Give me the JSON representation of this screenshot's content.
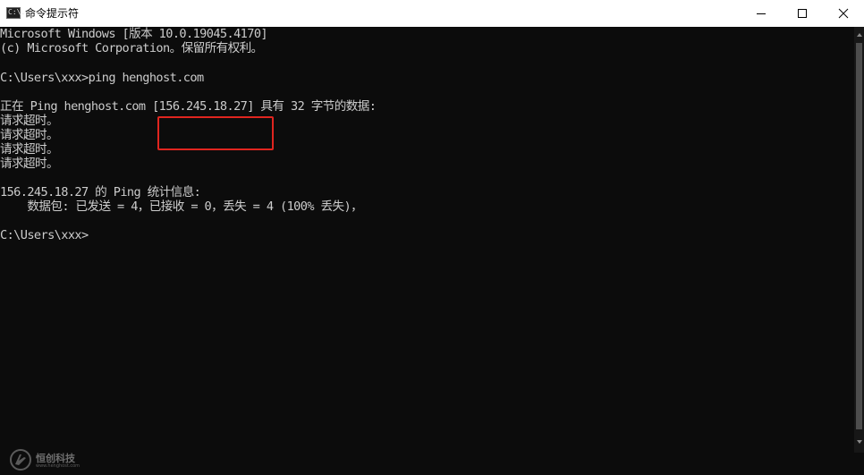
{
  "window": {
    "title": "命令提示符",
    "icon": "cmd-icon",
    "icon_label": "C:\\."
  },
  "console": {
    "lines": [
      "Microsoft Windows [版本 10.0.19045.4170]",
      "(c) Microsoft Corporation。保留所有权利。",
      "",
      "C:\\Users\\xxx>ping henghost.com",
      "",
      "正在 Ping henghost.com [156.245.18.27] 具有 32 字节的数据:",
      "请求超时。",
      "请求超时。",
      "请求超时。",
      "请求超时。",
      "",
      "156.245.18.27 的 Ping 统计信息:",
      "    数据包: 已发送 = 4，已接收 = 0，丢失 = 4 (100% 丢失)，",
      "",
      "C:\\Users\\xxx>"
    ],
    "highlighted_text": "[156.245.18.27]",
    "highlight_color": "#e0251f",
    "text_color": "#cccccc",
    "background_color": "#0c0c0c"
  },
  "watermark": {
    "name": "恒创科技",
    "site": "www.henghost.com"
  }
}
